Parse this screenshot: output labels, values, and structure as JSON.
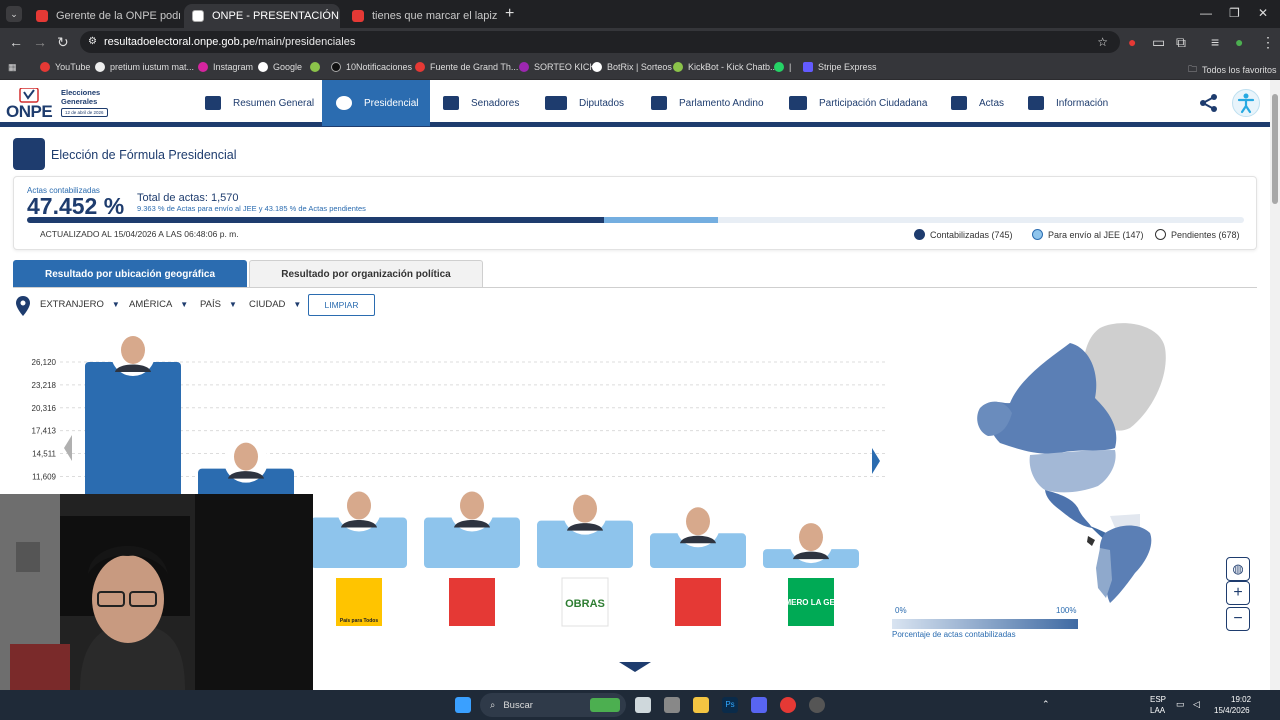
{
  "browser": {
    "tabs": [
      {
        "title": "Gerente de la ONPE podría seg",
        "active": false
      },
      {
        "title": "ONPE - PRESENTACIÓN DE RES",
        "active": true
      },
      {
        "title": "tienes que marcar el lapiz caraj",
        "active": false
      }
    ],
    "url_host": "resultadoelectoral.onpe.gob.pe",
    "url_path": "/main/presidenciales",
    "bookmarks": [
      "YouTube",
      "pretium iustum mat...",
      "Instagram",
      "Google",
      "10Notificaciones",
      "Fuente de Grand Th...",
      "SORTEO KICK",
      "BotRix | Sorteos",
      "KickBot - Kick Chatb...",
      "|",
      "Stripe Express"
    ],
    "all_bookmarks": "Todos los favoritos"
  },
  "site": {
    "logo_text": "ONPE",
    "logo_sub1": "Elecciones",
    "logo_sub2": "Generales",
    "logo_date": "12 de abril de 2026",
    "nav": [
      {
        "label": "Resumen General",
        "icon": "dashboard-icon",
        "active": false
      },
      {
        "label": "Presidencial",
        "icon": "seal-icon",
        "active": true
      },
      {
        "label": "Senadores",
        "icon": "senate-icon",
        "active": false
      },
      {
        "label": "Diputados",
        "icon": "congress-icon",
        "active": false
      },
      {
        "label": "Parlamento Andino",
        "icon": "globe-parliament-icon",
        "active": false
      },
      {
        "label": "Participación Ciudadana",
        "icon": "people-icon",
        "active": false
      },
      {
        "label": "Actas",
        "icon": "clipboard-check-icon",
        "active": false
      },
      {
        "label": "Información",
        "icon": "info-document-icon",
        "active": false
      }
    ]
  },
  "page": {
    "title": "Elección de Fórmula Presidencial"
  },
  "summary": {
    "pct_label": "Actas contabilizadas",
    "pct_value": "47.452 %",
    "total_actas": "Total de actas: 1,570",
    "pending_note": "9.363 % de Actas para envío al JEE y 43.185 % de Actas pendientes",
    "updated": "ACTUALIZADO AL 15/04/2026 A LAS 06:48:06 p. m.",
    "progress": {
      "contabilizadas": 0.4745,
      "jee": 0.0936
    },
    "legend": [
      {
        "label": "Contabilizadas (745)",
        "color": "#1e3c6e"
      },
      {
        "label": "Para envío al JEE (147)",
        "color": "#74aee0"
      },
      {
        "label": "Pendientes (678)",
        "color": "#ffffff"
      }
    ]
  },
  "result_tabs": {
    "geo": "Resultado por ubicación geográfica",
    "org": "Resultado por organización política"
  },
  "filters": {
    "items": [
      "EXTRANJERO",
      "AMÉRICA",
      "PAÍS",
      "CIUDAD"
    ],
    "clear": "LIMPIAR"
  },
  "chart_data": {
    "type": "bar",
    "y_ticks": [
      "26,120",
      "23,218",
      "20,316",
      "17,413",
      "14,511",
      "11,609"
    ],
    "ylim": [
      0,
      26120
    ],
    "bars": [
      {
        "value": 26120,
        "color": "#2b6cb0",
        "party_logo": ""
      },
      {
        "value": 12600,
        "color": "#2b6cb0",
        "party_logo": ""
      },
      {
        "value": 6400,
        "color": "#8ec4ec",
        "party_logo": "País para Todos"
      },
      {
        "value": 6400,
        "color": "#8ec4ec",
        "party_logo": ""
      },
      {
        "value": 6000,
        "color": "#8ec4ec",
        "party_logo": "OBRAS"
      },
      {
        "value": 4400,
        "color": "#8ec4ec",
        "party_logo": ""
      },
      {
        "value": 2400,
        "color": "#8ec4ec",
        "party_logo": "PRIMERO LA GENTE"
      }
    ]
  },
  "map": {
    "scale_min": "0%",
    "scale_max": "100%",
    "scale_label": "Porcentaje de actas contabilizadas",
    "controls": [
      "globe-icon",
      "plus-icon",
      "minus-icon"
    ]
  },
  "taskbar": {
    "search": "Buscar",
    "lang1": "ESP",
    "lang2": "LAA",
    "time": "19:02",
    "date": "15/4/2026"
  }
}
